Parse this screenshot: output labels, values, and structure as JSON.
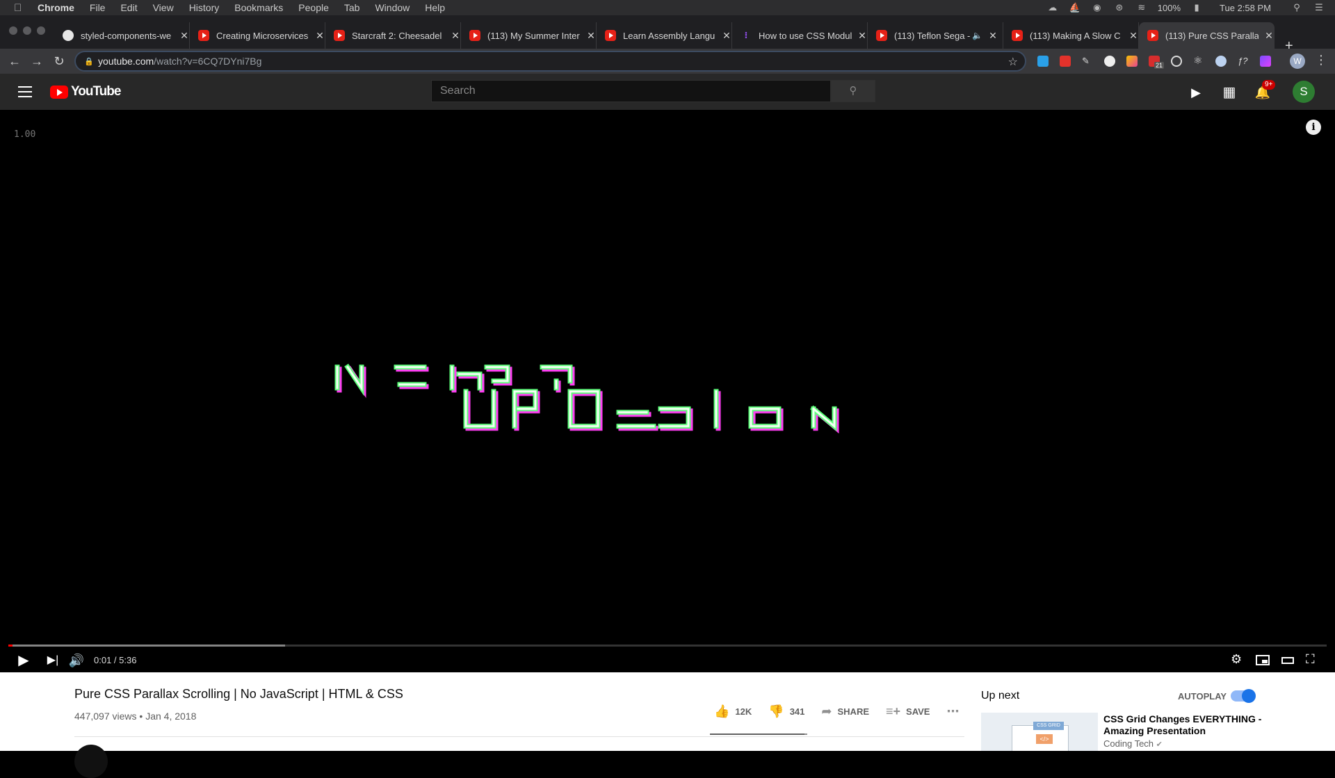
{
  "menubar": {
    "app": "Chrome",
    "items": [
      "File",
      "Edit",
      "View",
      "History",
      "Bookmarks",
      "People",
      "Tab",
      "Window",
      "Help"
    ],
    "battery": "100%",
    "clock": "Tue 2:58 PM"
  },
  "tabs": [
    {
      "title": "styled-components-we",
      "icon": "github-icon"
    },
    {
      "title": "Creating Microservices",
      "icon": "youtube-icon"
    },
    {
      "title": "Starcraft 2: Cheesadel",
      "icon": "youtube-icon"
    },
    {
      "title": "(113) My Summer Inter",
      "icon": "youtube-icon"
    },
    {
      "title": "Learn Assembly Langu",
      "icon": "youtube-icon"
    },
    {
      "title": "How to use CSS Modul",
      "icon": "medium-icon"
    },
    {
      "title": "(113) Teflon Sega -",
      "icon": "youtube-icon"
    },
    {
      "title": "(113) Making A Slow C",
      "icon": "youtube-icon"
    },
    {
      "title": "(113) Pure CSS Paralla",
      "icon": "youtube-icon"
    }
  ],
  "address": {
    "host": "youtube.com",
    "path": "/watch?v=6CQ7DYni7Bg"
  },
  "profile_initial": "W",
  "extension_badge": "21",
  "youtube": {
    "logo_text": "YouTube",
    "search_placeholder": "Search",
    "notif_badge": "9+",
    "avatar_initial": "S"
  },
  "player": {
    "speed_overlay": "1.00",
    "time": "0:01 / 5:36",
    "played_fraction": 0.003,
    "loaded_fraction": 0.21
  },
  "video_info": {
    "title": "Pure CSS Parallax Scrolling | No JavaScript | HTML & CSS",
    "views": "447,097 views",
    "date": "Jan 4, 2018",
    "likes": "12K",
    "dislikes": "341",
    "share": "SHARE",
    "save": "SAVE",
    "like_ratio": 0.97
  },
  "sidebar": {
    "up_next": "Up next",
    "autoplay": "AUTOPLAY",
    "rec_title": "CSS Grid Changes EVERYTHING - Amazing Presentation",
    "rec_channel": "Coding Tech",
    "rec_thumb_label": "CSS GRID"
  },
  "colors": {
    "yt_red": "#ff0000",
    "autoplay_blue": "#1a73e8",
    "glitch_green": "#5dff7a",
    "glitch_magenta": "#ff3df3"
  }
}
